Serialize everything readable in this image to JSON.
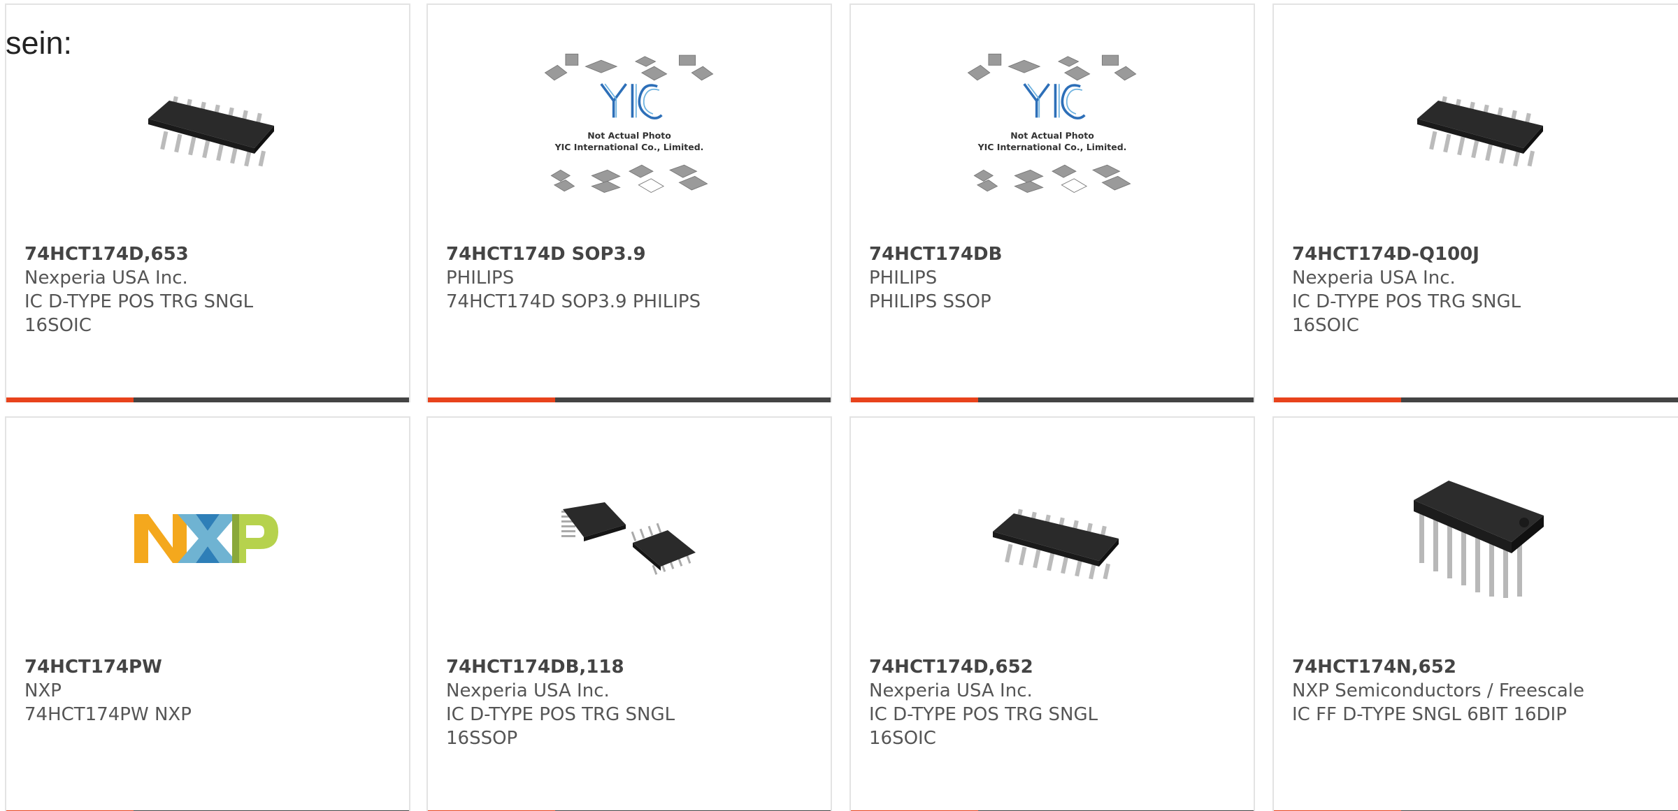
{
  "intro_text": "sein:",
  "colors": {
    "accent": "#e8431c",
    "bar": "#444444",
    "border": "#e3e3e3"
  },
  "products": [
    {
      "part": "74HCT174D,653",
      "manufacturer": "Nexperia USA Inc.",
      "desc_line1": "IC D-TYPE POS TRG SNGL",
      "desc_line2": "16SOIC",
      "image": "soic-chip"
    },
    {
      "part": "74HCT174D SOP3.9",
      "manufacturer": "PHILIPS",
      "desc_line1": "74HCT174D SOP3.9 PHILIPS",
      "desc_line2": "",
      "image": "yic-placeholder",
      "image_text1": "Not Actual Photo",
      "image_text2": "YIC International Co., Limited."
    },
    {
      "part": "74HCT174DB",
      "manufacturer": "PHILIPS",
      "desc_line1": "PHILIPS SSOP",
      "desc_line2": "",
      "image": "yic-placeholder",
      "image_text1": "Not Actual Photo",
      "image_text2": "YIC International Co., Limited."
    },
    {
      "part": "74HCT174D-Q100J",
      "manufacturer": "Nexperia USA Inc.",
      "desc_line1": "IC D-TYPE POS TRG SNGL",
      "desc_line2": "16SOIC",
      "image": "soic-chip"
    },
    {
      "part": "74HCT174PW",
      "manufacturer": "NXP",
      "desc_line1": "74HCT174PW NXP",
      "desc_line2": "",
      "image": "nxp-logo"
    },
    {
      "part": "74HCT174DB,118",
      "manufacturer": "Nexperia USA Inc.",
      "desc_line1": "IC D-TYPE POS TRG SNGL",
      "desc_line2": "16SSOP",
      "image": "ssop-chips"
    },
    {
      "part": "74HCT174D,652",
      "manufacturer": "Nexperia USA Inc.",
      "desc_line1": "IC D-TYPE POS TRG SNGL",
      "desc_line2": "16SOIC",
      "image": "soic-chip"
    },
    {
      "part": "74HCT174N,652",
      "manufacturer": "NXP Semiconductors / Freescale",
      "desc_line1": "IC FF D-TYPE SNGL 6BIT 16DIP",
      "desc_line2": "",
      "image": "dip-chip"
    }
  ]
}
